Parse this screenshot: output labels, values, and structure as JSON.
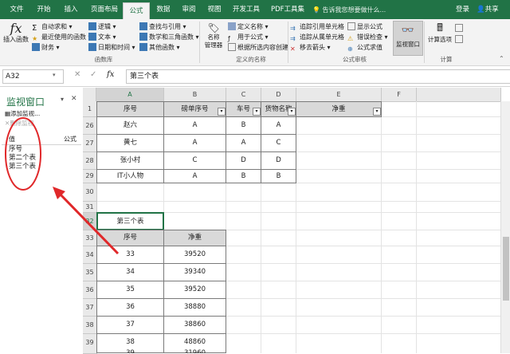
{
  "tabs": [
    "文件",
    "开始",
    "插入",
    "页面布局",
    "公式",
    "数据",
    "审阅",
    "视图",
    "开发工具",
    "PDF工具集"
  ],
  "active_tab": "公式",
  "tell_me": "告诉我您想要做什么...",
  "login": "登录",
  "share": "共享",
  "ribbon": {
    "insert_function": "插入函数",
    "autosum": "自动求和",
    "recent": "最近使用的函数",
    "financial": "财务",
    "logical": "逻辑",
    "text": "文本",
    "datetime": "日期和时间",
    "lookup": "查找与引用",
    "math": "数学和三角函数",
    "other": "其他函数",
    "group_library": "函数库",
    "name_manager": "名称\n管理器",
    "define_name": "定义名称",
    "use_in_formula": "用于公式",
    "create_from_selection": "根据所选内容创建",
    "group_names": "定义的名称",
    "trace_precedents": "追踪引用单元格",
    "trace_dependents": "追踪从属单元格",
    "remove_arrows": "移去箭头",
    "show_formulas": "显示公式",
    "error_checking": "错误检查",
    "evaluate_formula": "公式求值",
    "group_audit": "公式审核",
    "watch_window": "监视窗口",
    "calc_options": "计算选项",
    "group_calc": "计算"
  },
  "formula_bar": {
    "name_box": "A32",
    "fx": "fx",
    "content": "第三个表"
  },
  "watch_pane": {
    "title": "监视窗口",
    "add": "添加监视...",
    "delete": "删除监视",
    "col_value": "值",
    "col_formula": "公式",
    "items": [
      "序号",
      "第二个表",
      "第三个表"
    ]
  },
  "columns": [
    "A",
    "B",
    "C",
    "D",
    "E",
    "F"
  ],
  "rows": [
    "1",
    "26",
    "27",
    "28",
    "29",
    "30",
    "31",
    "32",
    "33",
    "34",
    "35",
    "36",
    "37",
    "38",
    "39"
  ],
  "table1": {
    "headers": [
      "序号",
      "磅单序号",
      "车号",
      "货物名称",
      "净重"
    ],
    "rows": [
      [
        "赵六",
        "A",
        "B",
        "A"
      ],
      [
        "黄七",
        "A",
        "A",
        "C"
      ],
      [
        "张小村",
        "C",
        "D",
        "D"
      ],
      [
        "IT小人物",
        "A",
        "B",
        "B"
      ]
    ]
  },
  "table3": {
    "title": "第三个表",
    "headers": [
      "序号",
      "净重"
    ],
    "rows": [
      [
        "33",
        "39520"
      ],
      [
        "34",
        "39340"
      ],
      [
        "35",
        "39520"
      ],
      [
        "36",
        "38880"
      ],
      [
        "37",
        "38860"
      ],
      [
        "38",
        "48860"
      ],
      [
        "39",
        "31960"
      ]
    ]
  },
  "colors": {
    "excel_green": "#217346",
    "annotation_red": "#e0282a"
  }
}
